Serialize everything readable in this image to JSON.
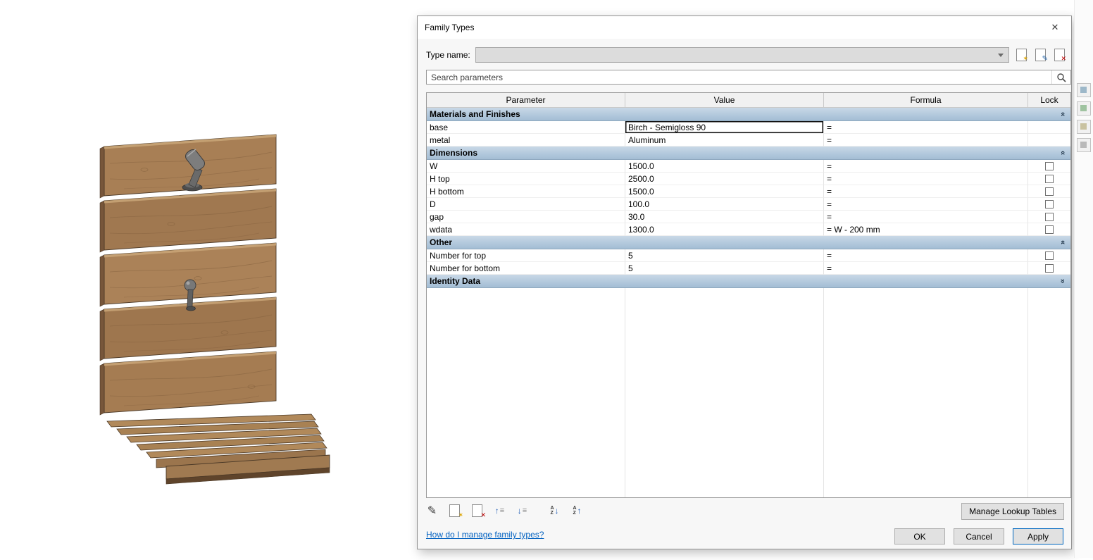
{
  "window": {
    "title": "Family Types",
    "close_glyph": "✕"
  },
  "type_name_label": "Type name:",
  "search": {
    "placeholder": "Search parameters"
  },
  "table": {
    "headers": [
      "Parameter",
      "Value",
      "Formula",
      "Lock"
    ],
    "groups": [
      {
        "name": "Materials and Finishes",
        "collapsed": false,
        "rows": [
          {
            "parameter": "base",
            "value": "Birch - Semigloss 90",
            "formula": "=",
            "editing": true
          },
          {
            "parameter": "metal",
            "value": "Aluminum",
            "formula": "="
          }
        ]
      },
      {
        "name": "Dimensions",
        "collapsed": false,
        "rows": [
          {
            "parameter": "W",
            "value": "1500.0",
            "formula": "=",
            "lock": false
          },
          {
            "parameter": "H top",
            "value": "2500.0",
            "formula": "=",
            "lock": false
          },
          {
            "parameter": "H bottom",
            "value": "1500.0",
            "formula": "=",
            "lock": false
          },
          {
            "parameter": "D",
            "value": "100.0",
            "formula": "=",
            "lock": false
          },
          {
            "parameter": "gap",
            "value": "30.0",
            "formula": "=",
            "lock": false
          },
          {
            "parameter": "wdata",
            "value": "1300.0",
            "formula": "= W - 200 mm",
            "lock": false
          }
        ]
      },
      {
        "name": "Other",
        "collapsed": false,
        "rows": [
          {
            "parameter": "Number for top",
            "value": "5",
            "formula": "=",
            "lock": false
          },
          {
            "parameter": "Number for bottom",
            "value": "5",
            "formula": "=",
            "lock": false
          }
        ]
      },
      {
        "name": "Identity Data",
        "collapsed": true,
        "rows": []
      }
    ]
  },
  "footer": {
    "help_link": "How do I manage family types?",
    "manage_lookup_label": "Manage Lookup Tables",
    "ok_label": "OK",
    "cancel_label": "Cancel",
    "apply_label": "Apply"
  },
  "icons": {
    "pencil": "✎",
    "star": "✶",
    "cross": "✕",
    "arrow_up": "↑",
    "arrow_down": "↓",
    "lines": "≡",
    "sort_a": "A",
    "sort_z": "Z",
    "chevron": "«"
  }
}
